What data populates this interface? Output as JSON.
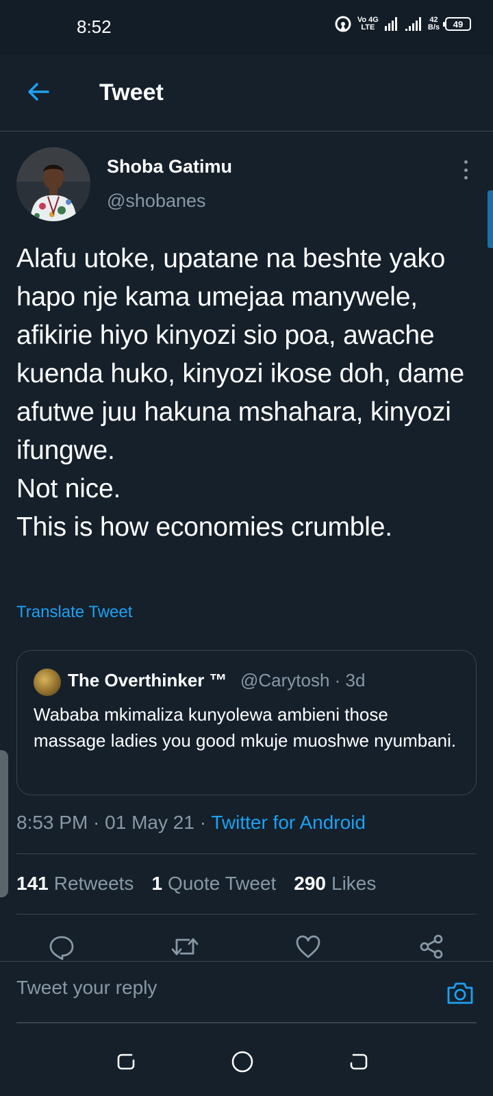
{
  "status_bar": {
    "time": "8:52",
    "network_top": "Vo 4G",
    "network_bottom": "LTE",
    "speed_value": "42",
    "speed_unit": "B/s",
    "battery": "49"
  },
  "header": {
    "title": "Tweet",
    "back_icon": "arrow-left-icon"
  },
  "tweet": {
    "display_name": "Shoba Gatimu",
    "handle": "@shobanes",
    "text": "Alafu utoke, upatane na beshte yako hapo nje kama umejaa manywele, afikirie hiyo kinyozi sio poa, awache kuenda huko, kinyozi ikose doh, dame afutwe juu hakuna mshahara, kinyozi ifungwe.\nNot nice.\nThis is how economies crumble.",
    "translate_label": "Translate Tweet",
    "time": "8:53 PM",
    "date": "01 May 21",
    "source": "Twitter for Android",
    "separator": " · "
  },
  "quote": {
    "display_name": "The Overthinker ™",
    "handle": "@Carytosh",
    "age": "3d",
    "text": "Wababa mkimaliza kunyolewa ambieni those massage ladies you good mkuje muoshwe nyumbani."
  },
  "stats": {
    "retweets_count": "141",
    "retweets_label": "Retweets",
    "quotes_count": "1",
    "quotes_label": "Quote Tweet",
    "likes_count": "290",
    "likes_label": "Likes"
  },
  "actions": [
    "reply-icon",
    "retweet-icon",
    "like-icon",
    "share-icon"
  ],
  "reply_bar": {
    "placeholder": "Tweet your reply"
  },
  "colors": {
    "background": "#15202b",
    "accent": "#1da1f2",
    "secondary_text": "#8899a6",
    "border": "#38444d"
  }
}
